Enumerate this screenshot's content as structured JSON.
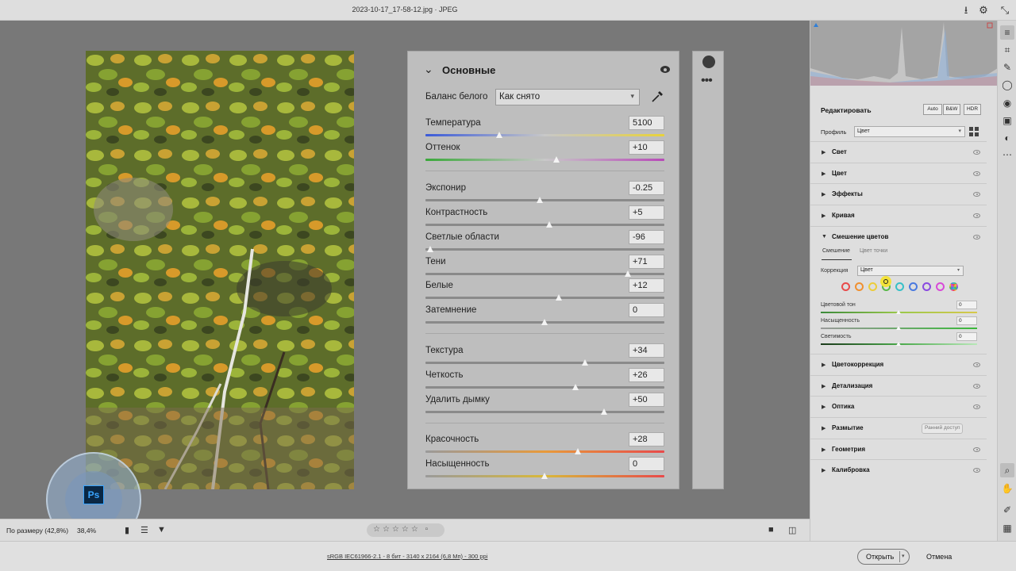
{
  "window": {
    "title": "2023-10-17_17-58-12.jpg  ·  JPEG"
  },
  "basic_panel": {
    "title": "Основные",
    "white_balance_label": "Баланс белого",
    "white_balance_value": "Как снято",
    "sliders": [
      {
        "label": "Температура",
        "value": "5100",
        "level": 0.31,
        "track": "temp"
      },
      {
        "label": "Оттенок",
        "value": "+10",
        "level": 0.55,
        "track": "tint"
      },
      {
        "label": "Экспонир",
        "value": "-0.25",
        "level": 0.48
      },
      {
        "label": "Контрастность",
        "value": "+5",
        "level": 0.52
      },
      {
        "label": "Светлые области",
        "value": "-96",
        "level": 0.02
      },
      {
        "label": "Тени",
        "value": "+71",
        "level": 0.85
      },
      {
        "label": "Белые",
        "value": "+12",
        "level": 0.56
      },
      {
        "label": "Затемнение",
        "value": "0",
        "level": 0.5
      },
      {
        "label": "Текстура",
        "value": "+34",
        "level": 0.67
      },
      {
        "label": "Четкость",
        "value": "+26",
        "level": 0.63
      },
      {
        "label": "Удалить дымку",
        "value": "+50",
        "level": 0.75
      },
      {
        "label": "Красочность",
        "value": "+28",
        "level": 0.64,
        "track": "vibrance"
      },
      {
        "label": "Насыщенность",
        "value": "0",
        "level": 0.5,
        "track": "saturation"
      }
    ]
  },
  "bottom_bar": {
    "zoom_label": "По размеру (42,8%)",
    "zoom_percent": "38,4%"
  },
  "status_bar": {
    "file_info": "sRGB IEC61966-2.1 - 8 бит - 3140 x 2164 (6,8 Мп) - 300 ppi",
    "open_button": "Открыть",
    "cancel_button": "Отмена"
  },
  "edit_panel": {
    "header": "Редактировать",
    "mode_buttons": [
      "Auto",
      "B&W",
      "HDR"
    ],
    "profile_label": "Профиль",
    "profile_value": "Цвет",
    "sections_top": [
      "Свет",
      "Цвет",
      "Эффекты",
      "Кривая"
    ],
    "color_mixer": {
      "title": "Смешение цветов",
      "tabs": [
        "Смешение",
        "Цвет точки"
      ],
      "correction_label": "Коррекция",
      "correction_value": "Цвет",
      "swatches": [
        "#e84a4a",
        "#f09030",
        "#eccc3a",
        "#58b848",
        "#38c0c8",
        "#4a7ae0",
        "#8a4ae0",
        "#d84ad8",
        "#ffffff"
      ],
      "sliders": [
        {
          "label": "Цветовой тон",
          "value": "0"
        },
        {
          "label": "Насыщенность",
          "value": "0"
        },
        {
          "label": "Светимость",
          "value": "0"
        }
      ]
    },
    "sections_bottom": [
      "Цветокоррекция",
      "Детализация",
      "Оптика",
      "Размытие",
      "Геометрия",
      "Калибровка"
    ],
    "early_access_badge": "Ранний доступ"
  }
}
